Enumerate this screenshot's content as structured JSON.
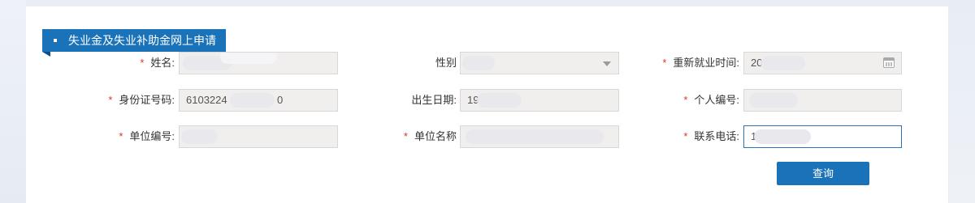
{
  "title": "失业金及失业补助金网上申请",
  "required_mark": "*",
  "fields": {
    "name": {
      "label": "姓名:",
      "value": ""
    },
    "gender": {
      "label": "性别",
      "value": ""
    },
    "reemploy_time": {
      "label": "重新就业时间:",
      "value": "20"
    },
    "id_number": {
      "label": "身份证号码:",
      "value": "6103224",
      "value_end": "0"
    },
    "birth_date": {
      "label": "出生日期:",
      "value": "19"
    },
    "personal_no": {
      "label": "个人编号:",
      "value": ""
    },
    "unit_no": {
      "label": "单位编号:",
      "value": ""
    },
    "unit_name": {
      "label": "单位名称",
      "value": ""
    },
    "phone": {
      "label": "联系电话:",
      "value": "1"
    }
  },
  "query_button": "查询",
  "icons": {
    "title_bullet": "square-bullet-icon",
    "select_arrow": "chevron-down-icon",
    "date_picker": "calendar-icon"
  },
  "colors": {
    "accent": "#1a72b8",
    "required": "#d9362b",
    "field_bg": "#f1eeee",
    "active_border": "#2a73b8"
  }
}
